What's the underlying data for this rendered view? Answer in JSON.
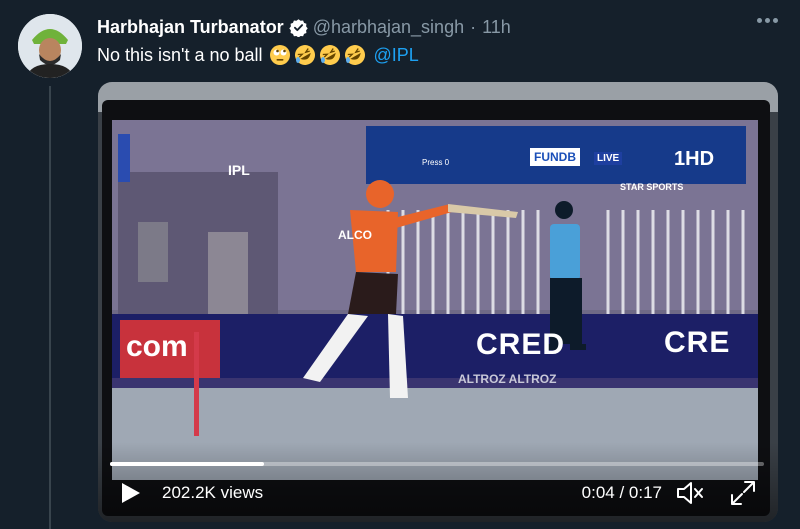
{
  "tweet": {
    "author_name": "Harbhajan Turbanator",
    "handle": "@harbhajan_singh",
    "separator": "·",
    "time": "11h",
    "text": "No this isn't a no ball",
    "emojis": [
      "rolling-eyes",
      "rofl",
      "rofl",
      "rofl"
    ],
    "mention": "@IPL"
  },
  "video": {
    "views": "202.2K views",
    "current_time": "0:04",
    "duration": "0:17",
    "time_display": "0:04 / 0:17",
    "progress_fraction": 0.235,
    "overlay": {
      "ipl_logo": "IPL",
      "press_label": "Press 0",
      "funda_label": "FUNDB",
      "live_badge": "LIVE",
      "channel": "1HD",
      "channel_name": "STAR SPORTS",
      "ad_cred": "CRED",
      "ad_cre": "CRE",
      "ad_com": "com",
      "ad_altroz": "ALTROZ ALTROZ",
      "batter_jersey_text": "ALCO"
    }
  },
  "colors": {
    "background": "#15202b",
    "accent": "#1da1f2",
    "muted": "#8899a6"
  }
}
